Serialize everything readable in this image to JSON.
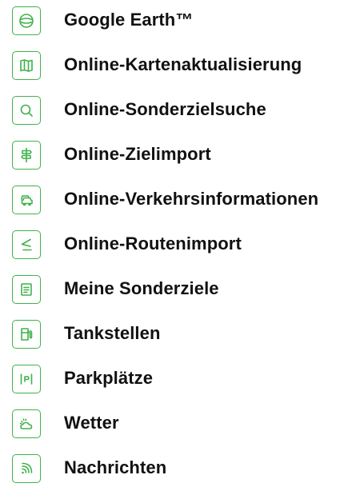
{
  "accent_color": "#3fb24a",
  "menu": {
    "items": [
      {
        "label": "Google Earth™",
        "icon": "globe-icon"
      },
      {
        "label": "Online-Kartenaktualisierung",
        "icon": "map-icon"
      },
      {
        "label": "Online-Sonderzielsuche",
        "icon": "search-icon"
      },
      {
        "label": "Online-Zielimport",
        "icon": "signpost-icon"
      },
      {
        "label": "Online-Verkehrsinformationen",
        "icon": "traffic-cars-icon"
      },
      {
        "label": "Online-Routenimport",
        "icon": "route-icon"
      },
      {
        "label": "Meine Sonderziele",
        "icon": "list-icon"
      },
      {
        "label": "Tankstellen",
        "icon": "fuel-pump-icon"
      },
      {
        "label": "Parkplätze",
        "icon": "parking-icon"
      },
      {
        "label": "Wetter",
        "icon": "weather-icon"
      },
      {
        "label": "Nachrichten",
        "icon": "rss-icon"
      }
    ]
  }
}
